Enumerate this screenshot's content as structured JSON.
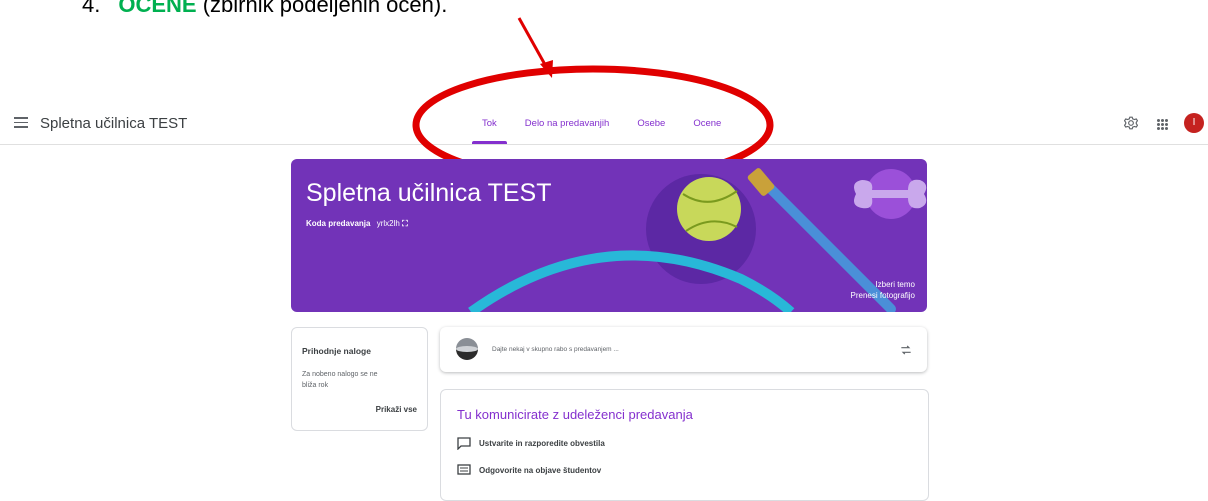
{
  "doc": {
    "number": "4.",
    "keyword": "OCENE",
    "rest": "(zbirnik podeljenih ocen)."
  },
  "header": {
    "class_title": "Spletna učilnica TEST",
    "tabs": [
      {
        "label": "Tok",
        "active": true
      },
      {
        "label": "Delo na predavanjih",
        "active": false
      },
      {
        "label": "Osebe",
        "active": false
      },
      {
        "label": "Ocene",
        "active": false
      }
    ],
    "avatar_initial": "I",
    "icons": [
      "menu-icon",
      "gear-icon",
      "apps-grid-icon"
    ]
  },
  "banner": {
    "title": "Spletna učilnica TEST",
    "code_label": "Koda predavanja",
    "code_value": "yrlx2lh",
    "select_theme": "Izberi temo",
    "upload_photo": "Prenesi fotografijo"
  },
  "upcoming": {
    "title": "Prihodnje naloge",
    "empty_text": "Za nobeno nalogo se ne bliža rok",
    "view_all": "Prikaži vse"
  },
  "share": {
    "placeholder": "Dajte nekaj v skupno rabo s predavanjem ..."
  },
  "communicate": {
    "title": "Tu komunicirate z udeleženci predavanja",
    "items": [
      {
        "label": "Ustvarite in razporedite obvestila",
        "icon": "message-icon"
      },
      {
        "label": "Odgovorite na objave študentov",
        "icon": "comment-list-icon"
      }
    ]
  },
  "colors": {
    "accent": "#8430ce",
    "banner": "#7233b8",
    "annotation": "#e00000",
    "keyword": "#00b050"
  }
}
